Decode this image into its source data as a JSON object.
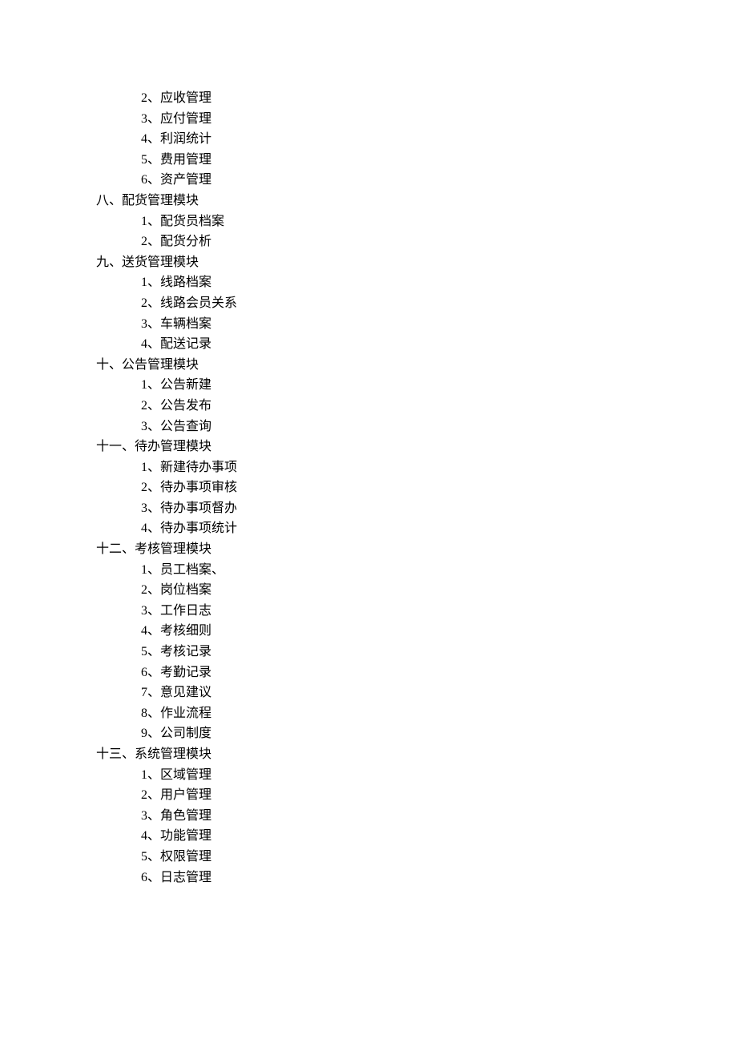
{
  "orphan_items": [
    "2、应收管理",
    "3、应付管理",
    "4、利润统计",
    "5、费用管理",
    "6、资产管理"
  ],
  "sections": [
    {
      "title": "八、配货管理模块",
      "items": [
        "1、配货员档案",
        "2、配货分析"
      ]
    },
    {
      "title": "九、送货管理模块",
      "items": [
        "1、线路档案",
        "2、线路会员关系",
        "3、车辆档案",
        "4、配送记录"
      ]
    },
    {
      "title": "十、公告管理模块",
      "items": [
        "1、公告新建",
        "2、公告发布",
        "3、公告查询"
      ]
    },
    {
      "title": "十一、待办管理模块",
      "items": [
        "1、新建待办事项",
        "2、待办事项审核",
        "3、待办事项督办",
        "4、待办事项统计"
      ]
    },
    {
      "title": "十二、考核管理模块",
      "items": [
        "1、员工档案、",
        "2、岗位档案",
        "3、工作日志",
        "4、考核细则",
        "5、考核记录",
        "6、考勤记录",
        "7、意见建议",
        "8、作业流程",
        "9、公司制度"
      ]
    },
    {
      "title": "十三、系统管理模块",
      "items": [
        "1、区域管理",
        "2、用户管理",
        "3、角色管理",
        "4、功能管理",
        "5、权限管理",
        "6、日志管理"
      ]
    }
  ]
}
